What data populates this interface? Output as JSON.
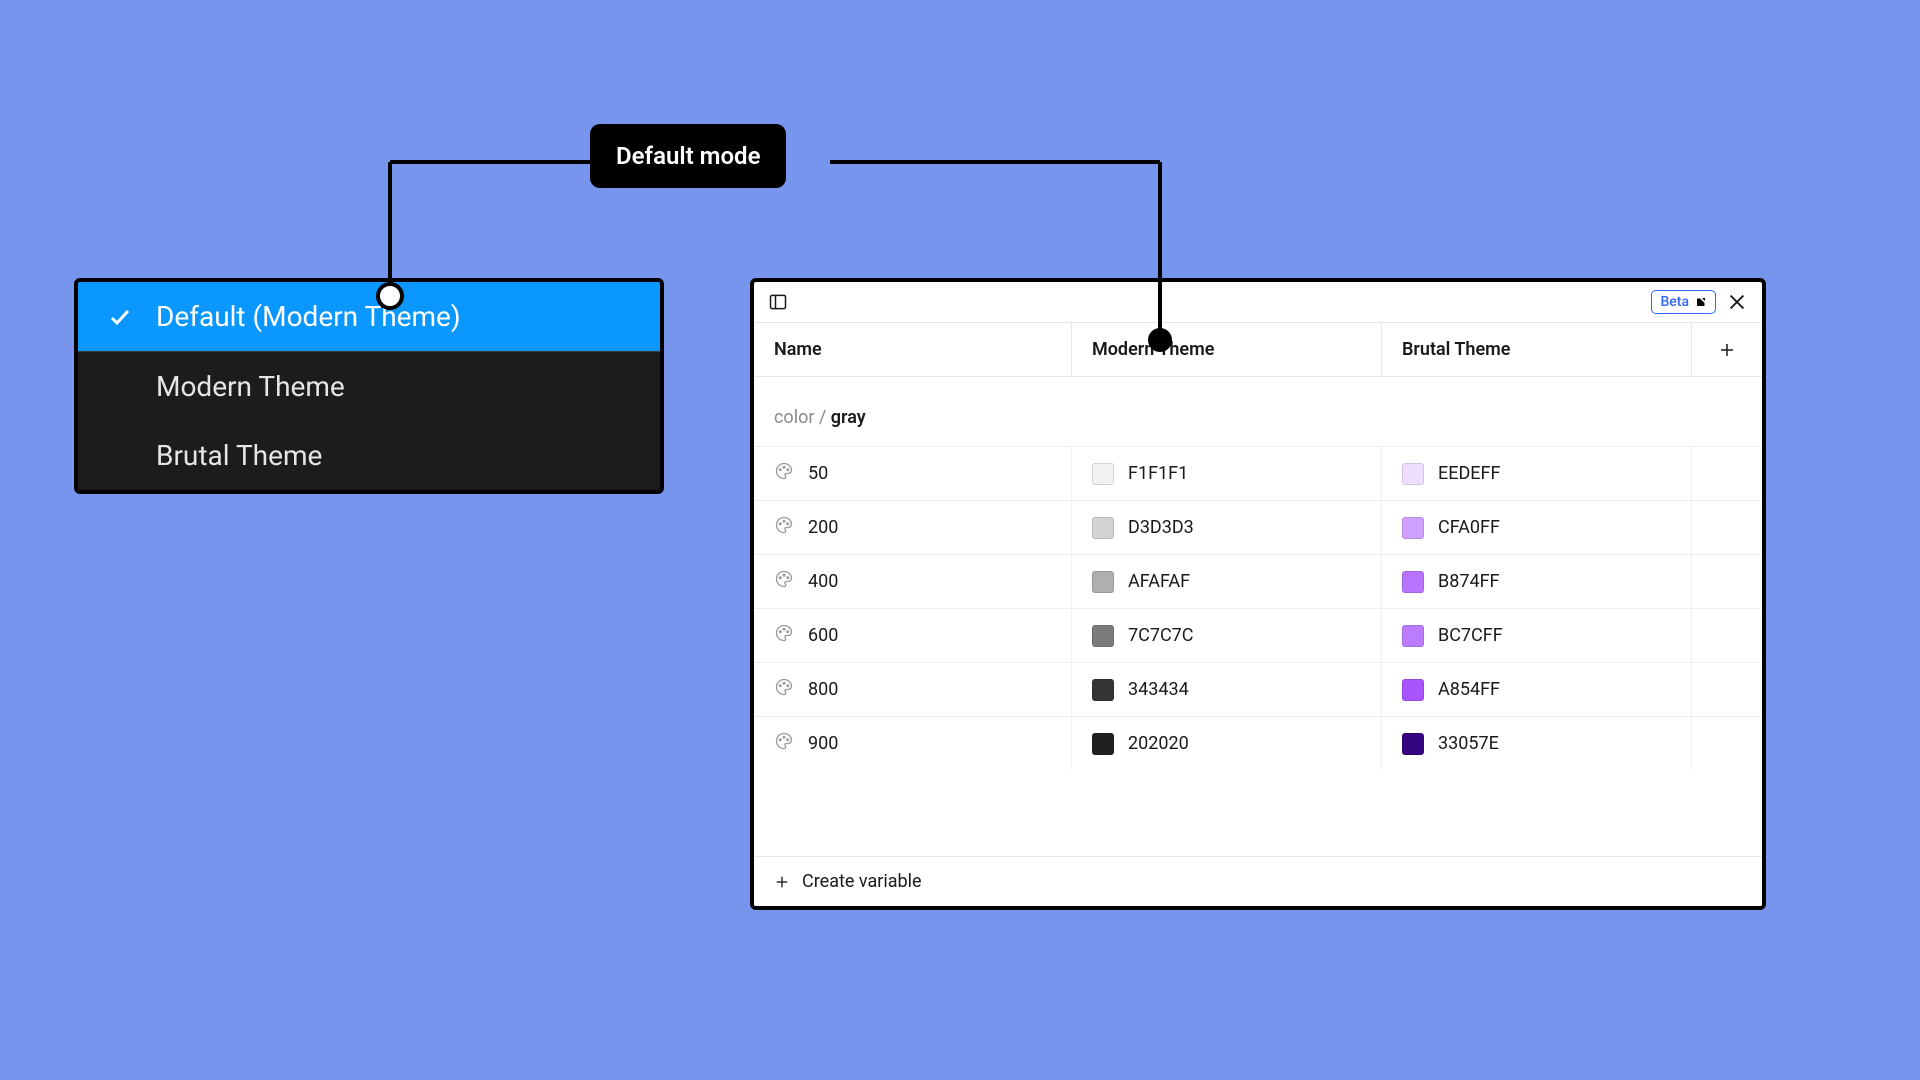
{
  "annotation": {
    "label": "Default mode"
  },
  "dropdown": {
    "items": [
      {
        "label": "Default (Modern Theme)",
        "selected": true
      },
      {
        "label": "Modern Theme",
        "selected": false
      },
      {
        "label": "Brutal Theme",
        "selected": false
      }
    ]
  },
  "panel": {
    "beta_label": "Beta",
    "columns": {
      "name": "Name",
      "mode_a": "Modern Theme",
      "mode_b": "Brutal Theme"
    },
    "group": {
      "prefix": "color / ",
      "name": "gray"
    },
    "rows": [
      {
        "name": "50",
        "a_hex": "F1F1F1",
        "a_color": "#F1F1F1",
        "b_hex": "EEDEFF",
        "b_color": "#EEDEFF"
      },
      {
        "name": "200",
        "a_hex": "D3D3D3",
        "a_color": "#D3D3D3",
        "b_hex": "CFA0FF",
        "b_color": "#CFA0FF"
      },
      {
        "name": "400",
        "a_hex": "AFAFAF",
        "a_color": "#AFAFAF",
        "b_hex": "B874FF",
        "b_color": "#B874FF"
      },
      {
        "name": "600",
        "a_hex": "7C7C7C",
        "a_color": "#7C7C7C",
        "b_hex": "BC7CFF",
        "b_color": "#BC7CFF"
      },
      {
        "name": "800",
        "a_hex": "343434",
        "a_color": "#343434",
        "b_hex": "A854FF",
        "b_color": "#A854FF"
      },
      {
        "name": "900",
        "a_hex": "202020",
        "a_color": "#202020",
        "b_hex": "33057E",
        "b_color": "#33057E"
      }
    ],
    "footer": {
      "create_label": "Create variable"
    }
  }
}
